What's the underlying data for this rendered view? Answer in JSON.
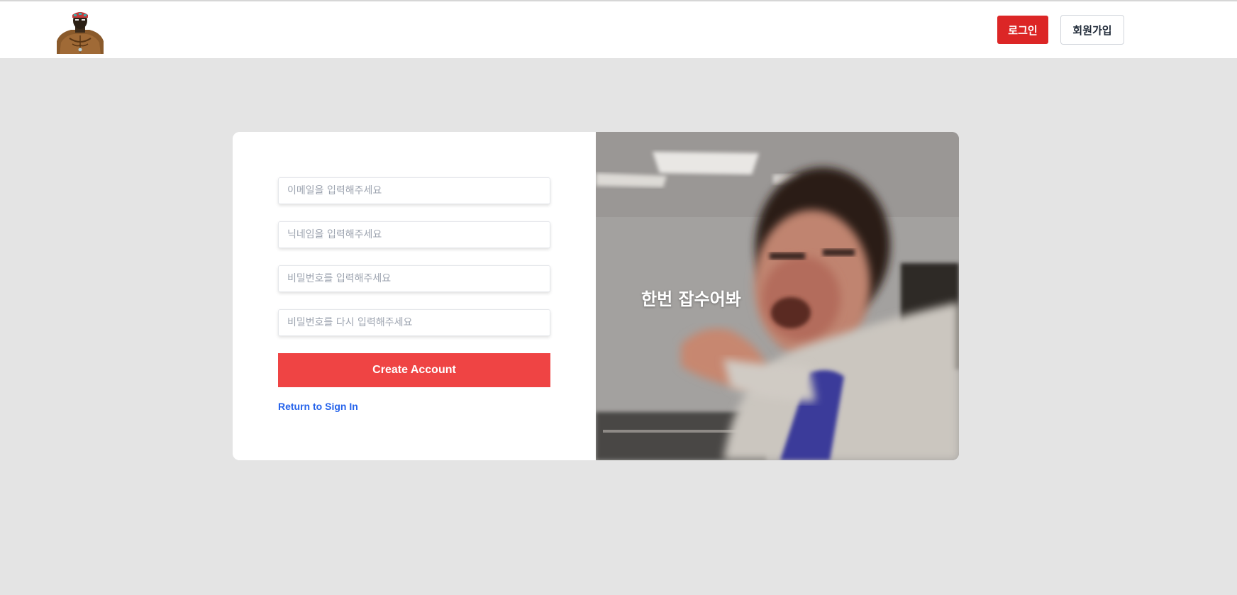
{
  "header": {
    "logo_icon": "muscular-man-logo-icon",
    "login_label": "로그인",
    "signup_label": "회원가입",
    "colors": {
      "login_bg": "#dc2626",
      "login_text": "#ffffff"
    }
  },
  "signup_form": {
    "email": {
      "placeholder": "이메일을 입력해주세요",
      "value": ""
    },
    "nickname": {
      "placeholder": "닉네임을 입력해주세요",
      "value": ""
    },
    "password": {
      "placeholder": "비밀번호를 입력해주세요",
      "value": ""
    },
    "password_confirm": {
      "placeholder": "비밀번호를 다시 입력해주세요",
      "value": ""
    },
    "submit_label": "Create Account",
    "return_link_label": "Return to Sign In",
    "colors": {
      "submit_bg": "#ef4444",
      "link": "#2563eb"
    }
  },
  "promo": {
    "caption": "한번 잡수어봐",
    "image_icon": "laughing-man-photo"
  }
}
